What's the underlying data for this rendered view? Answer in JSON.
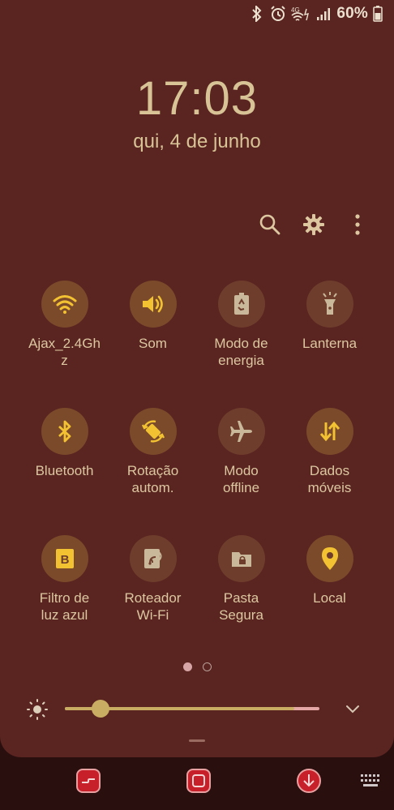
{
  "status": {
    "icons": [
      "bluetooth-icon",
      "alarm-icon",
      "wifi-4g-icon",
      "signal-icon",
      "battery-icon"
    ],
    "network_label": "4G",
    "battery_text": "60%"
  },
  "lockscreen": {
    "time": "17:03",
    "date": "qui, 4 de junho"
  },
  "toolbar": {
    "icons": [
      "search-icon",
      "gear-icon",
      "more-vert-icon"
    ]
  },
  "tiles": [
    {
      "label": "Ajax_2.4Gh\nz",
      "icon": "wifi-icon",
      "on": true
    },
    {
      "label": "Som",
      "icon": "volume-icon",
      "on": true
    },
    {
      "label": "Modo de\nenergia",
      "icon": "battery-recycle-icon",
      "on": false
    },
    {
      "label": "Lanterna",
      "icon": "flashlight-icon",
      "on": false
    },
    {
      "label": "Bluetooth",
      "icon": "bluetooth-icon",
      "on": true
    },
    {
      "label": "Rotação\nautom.",
      "icon": "rotate-icon",
      "on": true
    },
    {
      "label": "Modo\noffline",
      "icon": "airplane-icon",
      "on": false
    },
    {
      "label": "Dados\nmóveis",
      "icon": "data-arrows-icon",
      "on": true
    },
    {
      "label": "Filtro de\nluz azul",
      "icon": "blue-light-filter-icon",
      "on": true
    },
    {
      "label": "Roteador\nWi-Fi",
      "icon": "hotspot-icon",
      "on": false
    },
    {
      "label": "Pasta\nSegura",
      "icon": "secure-folder-icon",
      "on": false
    },
    {
      "label": "Local",
      "icon": "location-pin-icon",
      "on": true
    }
  ],
  "pager": {
    "pages": 2,
    "current": 1
  },
  "brightness": {
    "level": 0.14,
    "colors": {
      "fill": "#c9ad62",
      "track": "#e4a7a6"
    }
  },
  "colors": {
    "panel": "#5a2421",
    "accent_on": "#f2c233",
    "accent_off": "#c9b89a",
    "nav_button": "#c8202a"
  }
}
